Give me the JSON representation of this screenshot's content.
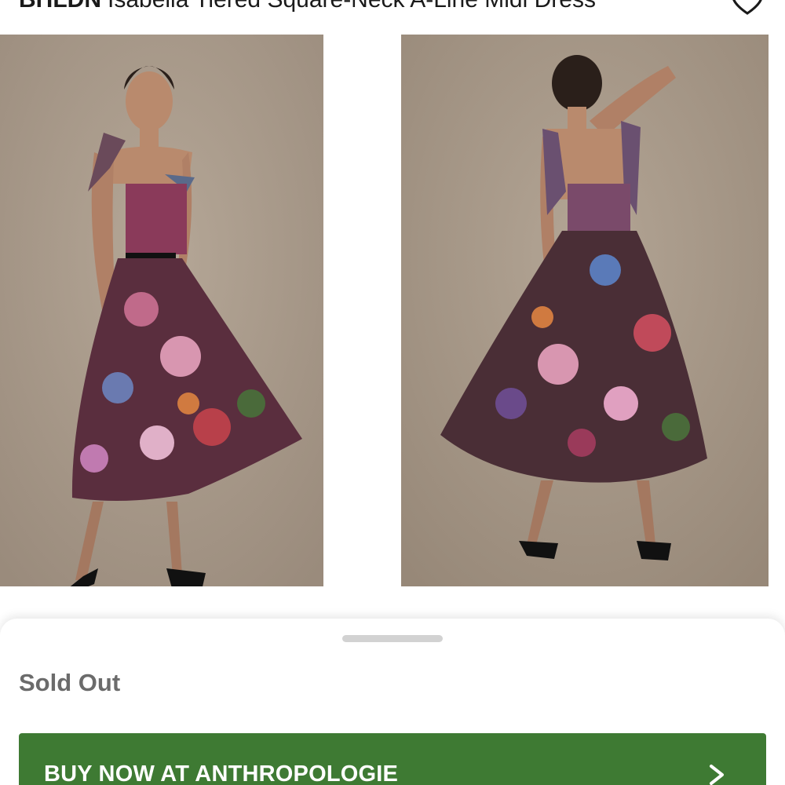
{
  "header": {
    "brand": "BHLDN",
    "product_title": "Isabella Tiered Square-Neck A-Line Midi Dress",
    "favorite_icon": "heart-icon"
  },
  "gallery": {
    "images": [
      {
        "view": "front",
        "description_icon": "product-photo"
      },
      {
        "view": "back",
        "description_icon": "product-photo"
      }
    ]
  },
  "sheet": {
    "status": "Sold Out",
    "buy_button_label": "BUY NOW AT ANTHROPOLOGIE",
    "buy_button_icon": "chevron-right-icon"
  },
  "colors": {
    "button_green": "#3e7a33",
    "status_gray": "#6b6b6b",
    "backdrop": "#a8998a"
  }
}
